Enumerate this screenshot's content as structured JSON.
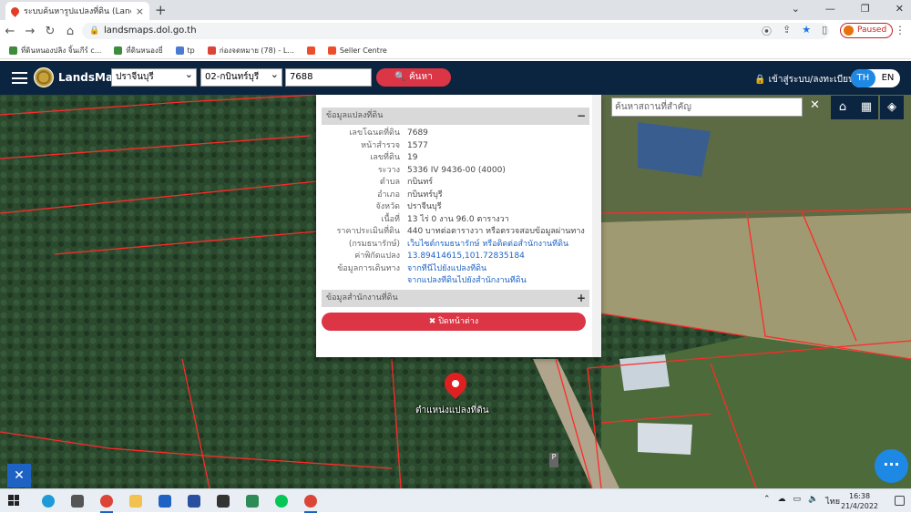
{
  "browser": {
    "tab_title": "ระบบค้นหารูปแปลงที่ดิน (LandsMaps)",
    "url": "landsmaps.dol.go.th",
    "profile_status": "Paused",
    "bookmarks": [
      "ที่ดินหนองปลิง จิ้นเกีร์ c...",
      "ที่ดินหนองยี่",
      "tp",
      "ก่องจดหมาย (78) - L...",
      "",
      "Seller Centre"
    ]
  },
  "app": {
    "brand": "LandsMaps",
    "province": "ปราจีนบุรี",
    "district": "02-กบินทร์บุรี",
    "parcel_number": "7688",
    "search_label": "ค้นหา",
    "login_label": "เข้าสู่ระบบ/ลงทะเบียน",
    "lang_th": "TH",
    "lang_en": "EN",
    "place_search_placeholder": "ค้นหาสถานที่สำคัญ"
  },
  "popup": {
    "section1_title": "ข้อมูลแปลงที่ดิน",
    "section1_toggle": "−",
    "rows": [
      {
        "key": "เลขโฉนดที่ดิน",
        "value": "7689"
      },
      {
        "key": "หน้าสำรวจ",
        "value": "1577"
      },
      {
        "key": "เลขที่ดิน",
        "value": "19"
      },
      {
        "key": "ระวาง",
        "value": "5336 IV 9436-00 (4000)"
      },
      {
        "key": "ตำบล",
        "value": "กบินทร์"
      },
      {
        "key": "อำเภอ",
        "value": "กบินทร์บุรี"
      },
      {
        "key": "จังหวัด",
        "value": "ปราจีนบุรี"
      },
      {
        "key": "เนื้อที่",
        "value": "13 ไร่ 0 งาน 96.0 ตารางวา"
      },
      {
        "key": "ราคาประเมินที่ดิน",
        "value": "440 บาทต่อตารางวา หรือตรวจสอบข้อมูลผ่านทาง"
      },
      {
        "key": "(กรมธนารักษ์)",
        "value": "เว็บไซต์กรมธนารักษ์ หรือติดต่อสำนักงานที่ดิน"
      },
      {
        "key": "ค่าพิกัดแปลง",
        "value": "13.89414615,101.72835184"
      },
      {
        "key": "ข้อมูลการเดินทาง",
        "value": "จากที่นี่ไปยังแปลงที่ดิน"
      },
      {
        "key": "",
        "value": "จากแปลงที่ดินไปยังสำนักงานที่ดิน"
      }
    ],
    "section2_title": "ข้อมูลสำนักงานที่ดิน",
    "section2_toggle": "+",
    "close_label": "✖ ปิดหน้าต่าง"
  },
  "map": {
    "marker_label": "ตำแหน่งแปลงที่ดิน",
    "road_label": "P"
  },
  "taskbar": {
    "time": "16:38",
    "date": "21/4/2022",
    "lang": "ไทย"
  },
  "colors": {
    "header": "#0b2540",
    "accent": "#dc3545",
    "parcel_line": "#ff2a2a"
  }
}
